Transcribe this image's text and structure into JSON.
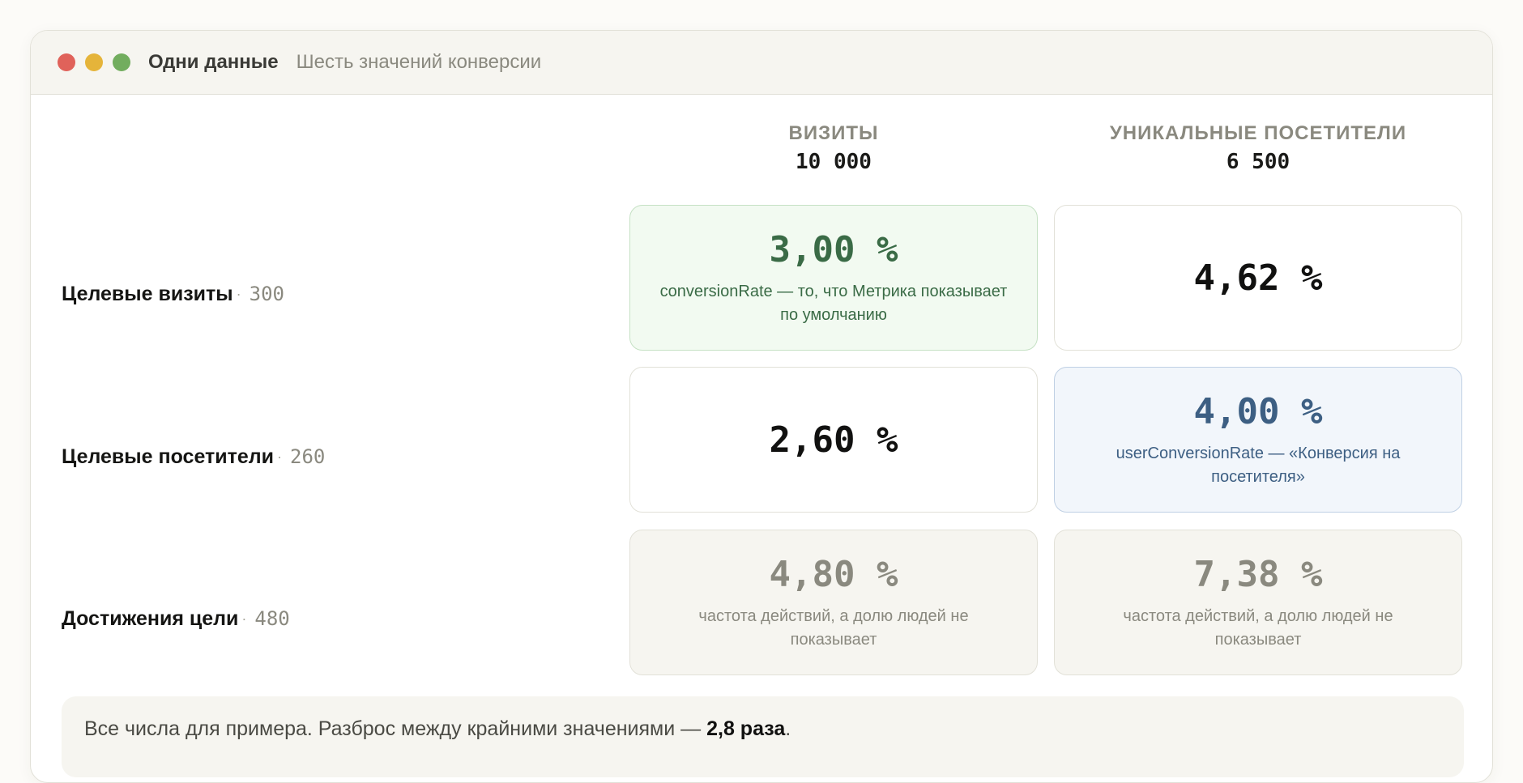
{
  "window": {
    "title": "Одни данные",
    "subtitle": "Шесть значений конверсии"
  },
  "columns": [
    {
      "label": "Визиты",
      "value": "10 000"
    },
    {
      "label": "Уникальные посетители",
      "value": "6 500"
    }
  ],
  "rows": [
    {
      "label": "Целевые визиты",
      "separator": "·",
      "count": "300"
    },
    {
      "label": "Целевые посетители",
      "separator": "·",
      "count": "260"
    },
    {
      "label": "Достижения цели",
      "separator": "·",
      "count": "480"
    }
  ],
  "cells": [
    [
      {
        "value": "3,00 %",
        "note": "conversionRate — то, что Метрика показывает по умолчанию",
        "style": "green"
      },
      {
        "value": "4,62 %",
        "note": "",
        "style": "plain"
      }
    ],
    [
      {
        "value": "2,60 %",
        "note": "",
        "style": "plain"
      },
      {
        "value": "4,00 %",
        "note": "userConversionRate — «Конверсия на посетителя»",
        "style": "blue"
      }
    ],
    [
      {
        "value": "4,80 %",
        "note": "частота действий, а долю людей не показывает",
        "style": "gray"
      },
      {
        "value": "7,38 %",
        "note": "частота действий, а долю людей не показывает",
        "style": "gray"
      }
    ]
  ],
  "footer": {
    "text": "Все числа для примера. Разброс между крайними значениями — ",
    "highlight": "2,8 раза",
    "end": "."
  },
  "colors": {
    "green": "#3a6b46",
    "blue": "#3d5f83",
    "gray": "#8a897f",
    "dot_red": "#e0625a",
    "dot_yellow": "#e5b43a",
    "dot_green": "#72ad5e"
  }
}
